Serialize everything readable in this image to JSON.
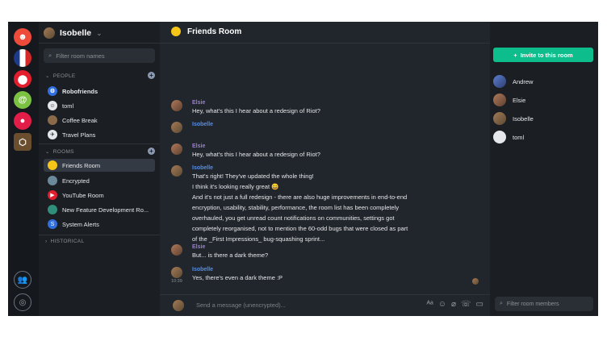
{
  "colors": {
    "accent": "#0dbd8b",
    "sender_purple": "#a077e0",
    "sender_blue": "#4c8ef5"
  },
  "user": {
    "name": "Isobelle"
  },
  "rail": {
    "communities": [
      "red",
      "french-flag",
      "red-circle",
      "green-spiral",
      "tomato",
      "hexagon"
    ]
  },
  "left": {
    "filter_placeholder": "Filter room names",
    "sections": {
      "people": "PEOPLE",
      "rooms": "ROOMS",
      "historical": "HISTORICAL"
    },
    "people": [
      "Robofriends",
      "toml",
      "Coffee Break",
      "Travel Plans"
    ],
    "rooms": [
      "Friends Room",
      "Encrypted",
      "YouTube Room",
      "New Feature Development Ro...",
      "System Alerts"
    ]
  },
  "header": {
    "room_name": "Friends Room"
  },
  "messages": [
    {
      "sender": "Elsie",
      "text": [
        "Hey, what's this I hear about a redesign of Riot?"
      ]
    },
    {
      "sender": "Isobelle",
      "text": []
    },
    {
      "sender": "Elsie",
      "text": [
        "Hey, what's this I hear about a redesign of Riot?"
      ]
    },
    {
      "sender": "Isobelle",
      "text": [
        "That's right! They've updated the whole thing!",
        "I think it's looking really great 😄",
        "And it's not just a full redesign - there are also huge improvements in end-to-end",
        "encryption, usability, stability, performance, the room list has been completely",
        "overhauled, you get unread count notifications on communities, settings got",
        "completely reorganised, not to mention the 60-odd bugs that were closed as part",
        "of the _First Impressions_ bug-squashing sprint..."
      ]
    },
    {
      "sender": "Elsie",
      "text": [
        "But... is there a dark theme?"
      ]
    },
    {
      "sender": "Isobelle",
      "text": [
        "Yes, there's even a dark theme :P"
      ],
      "time": "10:39"
    }
  ],
  "composer": {
    "placeholder": "Send a message (unencrypted)..."
  },
  "right": {
    "invite_label": "Invite to this room",
    "members": [
      "Andrew",
      "Elsie",
      "Isobelle",
      "toml"
    ],
    "filter_placeholder": "Filter room members"
  }
}
